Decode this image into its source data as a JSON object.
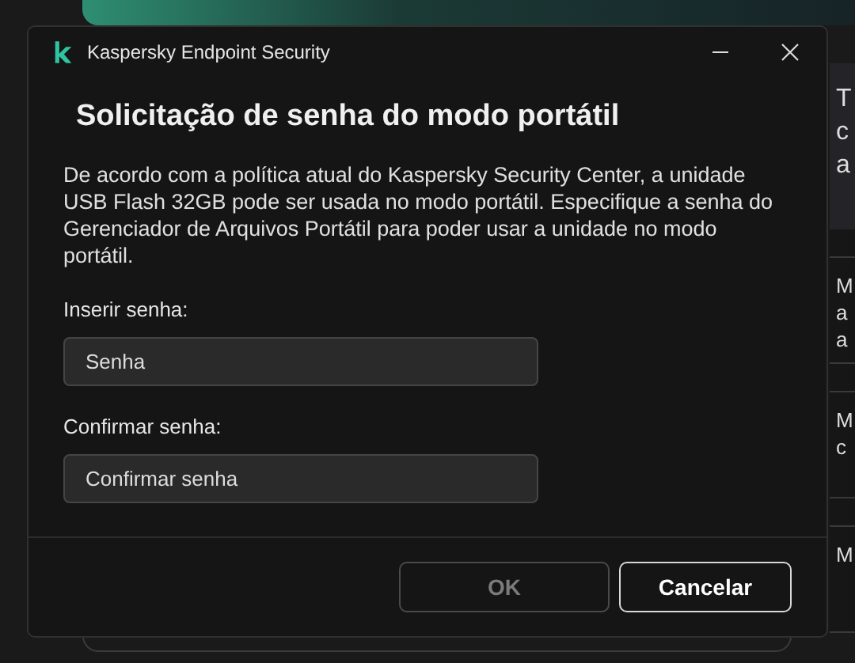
{
  "background_window": {
    "header_lines": [
      "T",
      "c",
      "a"
    ],
    "items": [
      {
        "lines": [
          "M",
          "a",
          "a"
        ]
      },
      {
        "lines": [
          "M",
          "c"
        ]
      },
      {
        "lines": [
          "M"
        ]
      }
    ]
  },
  "dialog": {
    "title": "Kaspersky Endpoint Security",
    "heading": "Solicitação de senha do modo portátil",
    "description": "De acordo com a política atual do Kaspersky Security Center, a unidade USB Flash 32GB pode ser usada no modo portátil. Especifique a senha do Gerenciador de Arquivos Portátil para poder usar a unidade no modo portátil.",
    "fields": [
      {
        "label": "Inserir senha:",
        "placeholder": "Senha"
      },
      {
        "label": "Confirmar senha:",
        "placeholder": "Confirmar senha"
      }
    ],
    "buttons": [
      {
        "label": "OK",
        "disabled": true
      },
      {
        "label": "Cancelar",
        "disabled": false
      }
    ]
  }
}
